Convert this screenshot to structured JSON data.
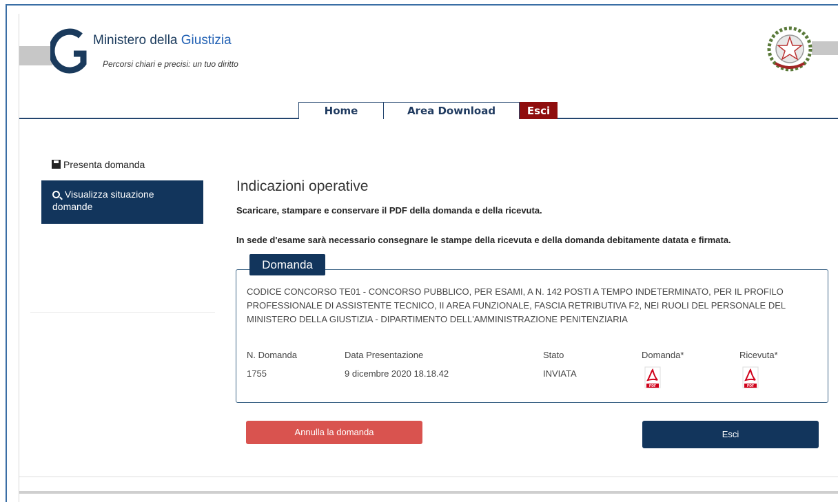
{
  "header": {
    "logo_initial": "G",
    "title_part1": "Ministero della ",
    "title_part2": "Giustizia",
    "subtitle": "Percorsi chiari e precisi: un tuo diritto"
  },
  "nav": {
    "home": "Home",
    "download": "Area Download",
    "esci": "Esci"
  },
  "sidebar": {
    "items": [
      {
        "label": "Presenta domanda",
        "icon": "save-icon"
      },
      {
        "label": "Visualizza situazione domande",
        "icon": "search-icon"
      }
    ]
  },
  "main": {
    "title": "Indicazioni operative",
    "instruction1": "Scaricare, stampare e conservare il PDF della domanda e della ricevuta.",
    "instruction2": "In sede d'esame sarà necessario consegnare le stampe della ricevuta e della domanda debitamente datata e firmata."
  },
  "panel": {
    "tab_label": "Domanda",
    "description": "CODICE CONCORSO TE01 - CONCORSO PUBBLICO, PER ESAMI, A N. 142 POSTI A TEMPO INDETERMINATO, PER IL PROFILO PROFESSIONALE DI ASSISTENTE TECNICO, II AREA FUNZIONALE, FASCIA RETRIBUTIVA F2, NEI RUOLI DEL PERSONALE DEL MINISTERO DELLA GIUSTIZIA - DIPARTIMENTO DELL'AMMINISTRAZIONE PENITENZIARIA",
    "columns": {
      "numero": "N. Domanda",
      "data": "Data Presentazione",
      "stato": "Stato",
      "domanda": "Domanda*",
      "ricevuta": "Ricevuta*"
    },
    "values": {
      "numero": "1755",
      "data": "9 dicembre 2020 18.18.42",
      "stato": "INVIATA"
    },
    "pdf_badge": "PDF"
  },
  "buttons": {
    "annulla": "Annulla la domanda",
    "esci": "Esci"
  },
  "colors": {
    "navy": "#12355c",
    "danger": "#d9534f",
    "esci_nav": "#8f0d0d"
  }
}
